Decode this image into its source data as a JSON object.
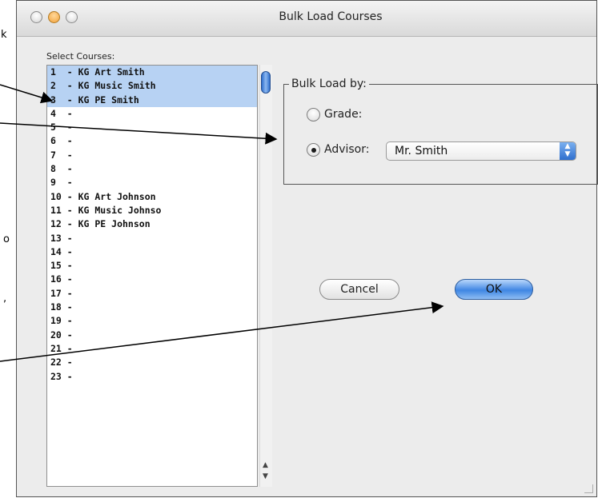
{
  "background_fragments": [
    "k",
    "o",
    ","
  ],
  "window": {
    "title": "Bulk Load Courses",
    "controls": [
      "close",
      "minimize",
      "zoom"
    ]
  },
  "select_courses": {
    "label": "Select Courses:",
    "rows": [
      {
        "text": "1  - KG Art Smith",
        "selected": true
      },
      {
        "text": "2  - KG Music Smith",
        "selected": true
      },
      {
        "text": "3  - KG PE Smith",
        "selected": true
      },
      {
        "text": "4  -",
        "selected": false
      },
      {
        "text": "5  -",
        "selected": false
      },
      {
        "text": "6  -",
        "selected": false
      },
      {
        "text": "7  -",
        "selected": false
      },
      {
        "text": "8  -",
        "selected": false
      },
      {
        "text": "9  -",
        "selected": false
      },
      {
        "text": "10 - KG Art Johnson",
        "selected": false
      },
      {
        "text": "11 - KG Music Johnso",
        "selected": false
      },
      {
        "text": "12 - KG PE Johnson",
        "selected": false
      },
      {
        "text": "13 -",
        "selected": false
      },
      {
        "text": "14 -",
        "selected": false
      },
      {
        "text": "15 -",
        "selected": false
      },
      {
        "text": "16 -",
        "selected": false
      },
      {
        "text": "17 -",
        "selected": false
      },
      {
        "text": "18 -",
        "selected": false
      },
      {
        "text": "19 -",
        "selected": false
      },
      {
        "text": "20 -",
        "selected": false
      },
      {
        "text": "21 -",
        "selected": false
      },
      {
        "text": "22 -",
        "selected": false
      },
      {
        "text": "23 -",
        "selected": false
      }
    ]
  },
  "bulk_load": {
    "title": "Bulk Load by:",
    "grade_label": "Grade:",
    "advisor_label": "Advisor:",
    "advisor_value": "Mr. Smith",
    "selected_option": "advisor"
  },
  "buttons": {
    "cancel": "Cancel",
    "ok": "OK"
  },
  "colors": {
    "selection": "#b7d2f3",
    "default_button": "#3f86e3"
  }
}
